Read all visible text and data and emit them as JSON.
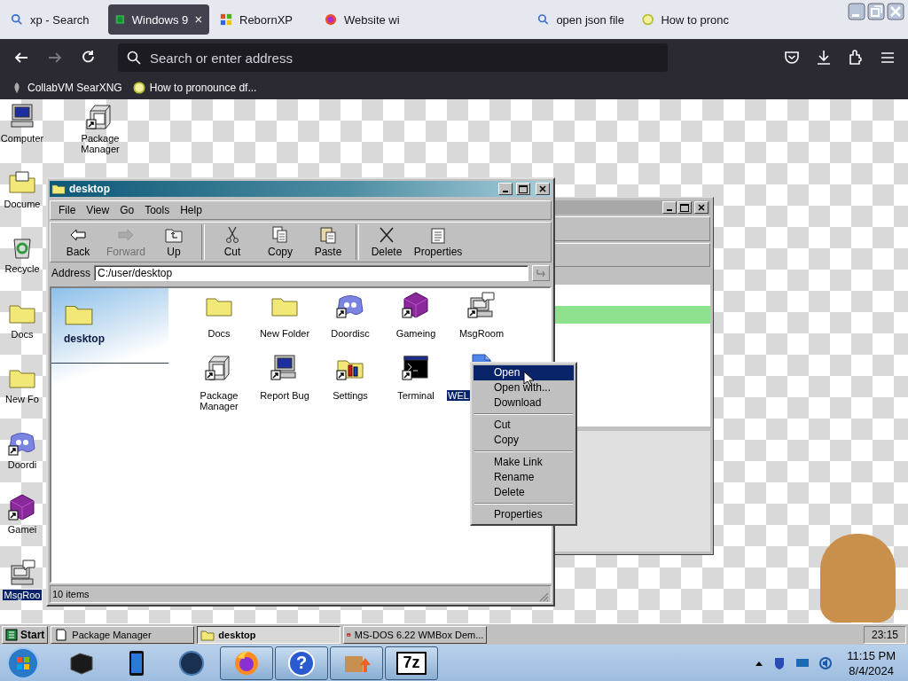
{
  "browser": {
    "tabs": [
      {
        "label": "xp - Search",
        "selected": false
      },
      {
        "label": "Windows 9",
        "selected": true
      },
      {
        "label": "RebornXP",
        "selected": false
      },
      {
        "label": "Website wi",
        "selected": false
      },
      {
        "label": "open json file",
        "selected": false
      },
      {
        "label": "How to pronc",
        "selected": false
      }
    ],
    "address": {
      "placeholder": "Search or enter address"
    },
    "bookmarks": [
      "CollabVM SearXNG",
      "How to pronounce df..."
    ]
  },
  "vm": {
    "desktop_columns": [
      {
        "icons": [
          {
            "label": "Computer",
            "kind": "computer",
            "shortcut": false,
            "selected": false
          },
          {
            "label": "Docume",
            "kind": "docs-folder",
            "shortcut": false,
            "selected": false
          },
          {
            "label": "Recycle",
            "kind": "recycle",
            "shortcut": false,
            "selected": false
          },
          {
            "label": "Docs",
            "kind": "folder",
            "shortcut": false,
            "selected": false
          },
          {
            "label": "New Fo",
            "kind": "folder",
            "shortcut": false,
            "selected": false
          },
          {
            "label": "Doordi",
            "kind": "chat",
            "shortcut": true,
            "selected": false
          },
          {
            "label": "Gamei",
            "kind": "cube",
            "shortcut": true,
            "selected": false
          },
          {
            "label": "MsgRoo",
            "kind": "messenger",
            "shortcut": false,
            "selected": true
          }
        ]
      },
      {
        "icons": [
          {
            "label": "Package Manager",
            "kind": "package",
            "shortcut": true,
            "selected": false
          }
        ]
      }
    ],
    "explorer": {
      "title": "desktop",
      "menu": [
        "File",
        "View",
        "Go",
        "Tools",
        "Help"
      ],
      "toolbar_groups": [
        [
          {
            "label": "Back",
            "kind": "back",
            "disabled": false
          },
          {
            "label": "Forward",
            "kind": "forward",
            "disabled": true
          },
          {
            "label": "Up",
            "kind": "up",
            "disabled": false
          }
        ],
        [
          {
            "label": "Cut",
            "kind": "cut",
            "disabled": false
          },
          {
            "label": "Copy",
            "kind": "copy",
            "disabled": false
          },
          {
            "label": "Paste",
            "kind": "paste",
            "disabled": false
          }
        ],
        [
          {
            "label": "Delete",
            "kind": "delete",
            "disabled": false
          },
          {
            "label": "Properties",
            "kind": "properties",
            "disabled": false
          }
        ]
      ],
      "address_label": "Address",
      "address": "C:/user/desktop",
      "panel_title": "desktop",
      "files": [
        {
          "label": "Docs",
          "kind": "folder",
          "shortcut": false,
          "selected": false
        },
        {
          "label": "New Folder",
          "kind": "folder",
          "shortcut": false,
          "selected": false
        },
        {
          "label": "Doordisc",
          "kind": "chat",
          "shortcut": true,
          "selected": false
        },
        {
          "label": "Gameing",
          "kind": "cube",
          "shortcut": true,
          "selected": false
        },
        {
          "label": "MsgRoom",
          "kind": "messenger",
          "shortcut": true,
          "selected": false
        },
        {
          "label": "Package Manager",
          "kind": "package",
          "shortcut": true,
          "selected": false
        },
        {
          "label": "Report Bug",
          "kind": "computer",
          "shortcut": true,
          "selected": false
        },
        {
          "label": "Settings",
          "kind": "settings",
          "shortcut": true,
          "selected": false
        },
        {
          "label": "Terminal",
          "kind": "terminal",
          "shortcut": true,
          "selected": false
        },
        {
          "label": "WEL",
          "kind": "file",
          "shortcut": false,
          "selected": true
        }
      ],
      "status": "10 items"
    },
    "context_menu": {
      "groups": [
        {
          "items": [
            {
              "label": "Open",
              "selected": true
            },
            {
              "label": "Open with...",
              "selected": false
            },
            {
              "label": "Download",
              "selected": false
            }
          ]
        },
        {
          "items": [
            {
              "label": "Cut",
              "selected": false
            },
            {
              "label": "Copy",
              "selected": false
            }
          ]
        },
        {
          "items": [
            {
              "label": "Make Link",
              "selected": false
            },
            {
              "label": "Rename",
              "selected": false
            },
            {
              "label": "Delete",
              "selected": false
            }
          ]
        },
        {
          "items": [
            {
              "label": "Properties",
              "selected": false
            }
          ]
        }
      ]
    },
    "taskbar": {
      "start": "Start",
      "tasks": [
        {
          "label": "Package Manager",
          "kind": "document",
          "selected": false
        },
        {
          "label": "desktop",
          "kind": "folder",
          "selected": true
        },
        {
          "label": "MS-DOS 6.22 WMBox Dem...",
          "kind": "dos",
          "selected": false
        }
      ],
      "clock": "23:15"
    }
  },
  "host_taskbar": {
    "pinned": [
      {
        "kind": "dark-box",
        "running": false
      },
      {
        "kind": "tablet",
        "running": false
      },
      {
        "kind": "sphere",
        "running": false
      },
      {
        "kind": "browser",
        "running": true
      },
      {
        "kind": "help",
        "glyph": "?",
        "running": true
      },
      {
        "kind": "picture",
        "running": true
      },
      {
        "kind": "archive",
        "glyph": "7z",
        "running": true
      }
    ],
    "time": "11:15 PM",
    "date": "8/4/2024"
  }
}
